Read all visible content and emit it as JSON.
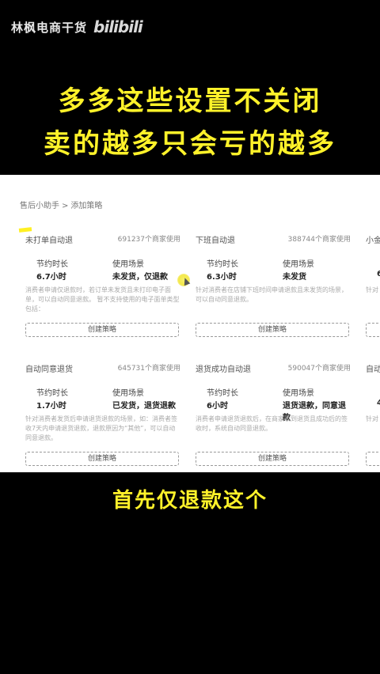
{
  "watermark": {
    "author": "林枫电商干货",
    "logo": "bilibili"
  },
  "headline": {
    "line1": "多多这些设置不关闭",
    "line2": "卖的越多只会亏的越多"
  },
  "breadcrumb": {
    "root": "售后小助手",
    "sep": ">",
    "current": "添加策略"
  },
  "labels": {
    "save_time": "节约时长",
    "scene": "使用场景",
    "create": "创建策略"
  },
  "cards": [
    {
      "title": "未打单自动退",
      "users": "691237个商家使用",
      "time": "6.7小时",
      "scene": "未发货，仅退款",
      "desc": "消费者申请仅退款时，若订单未发货且未打印电子面单，可以自动同意退款。 暂不支持使用的电子面单类型包括："
    },
    {
      "title": "下班自动退",
      "users": "388744个商家使用",
      "time": "6.3小时",
      "scene": "未发货",
      "desc": "针对消费者在店铺下班时间申请退款且未发货的场景，可以自动同意退款。"
    },
    {
      "title": "小金",
      "users": "",
      "time": "6",
      "scene": "",
      "desc": "针对"
    },
    {
      "title": "自动同意退货",
      "users": "645731个商家使用",
      "time": "1.7小时",
      "scene": "已发货，退货退款",
      "desc": "针对消费者发货后申请退货退款的场景，如：消费者签收7天内申请退货退款，退款原因为“其他”，可以自动同意退款。"
    },
    {
      "title": "退货成功自动退",
      "users": "590047个商家使用",
      "time": "6小时",
      "scene": "退货退款，同意退款",
      "desc": "消费者申请退货退款后，在商家收到退货且成功后的签收时，系统自动同意退款。"
    },
    {
      "title": "自动",
      "users": "",
      "time": "4",
      "scene": "",
      "desc": "针对 天内"
    }
  ],
  "caption": "首先仅退款这个"
}
